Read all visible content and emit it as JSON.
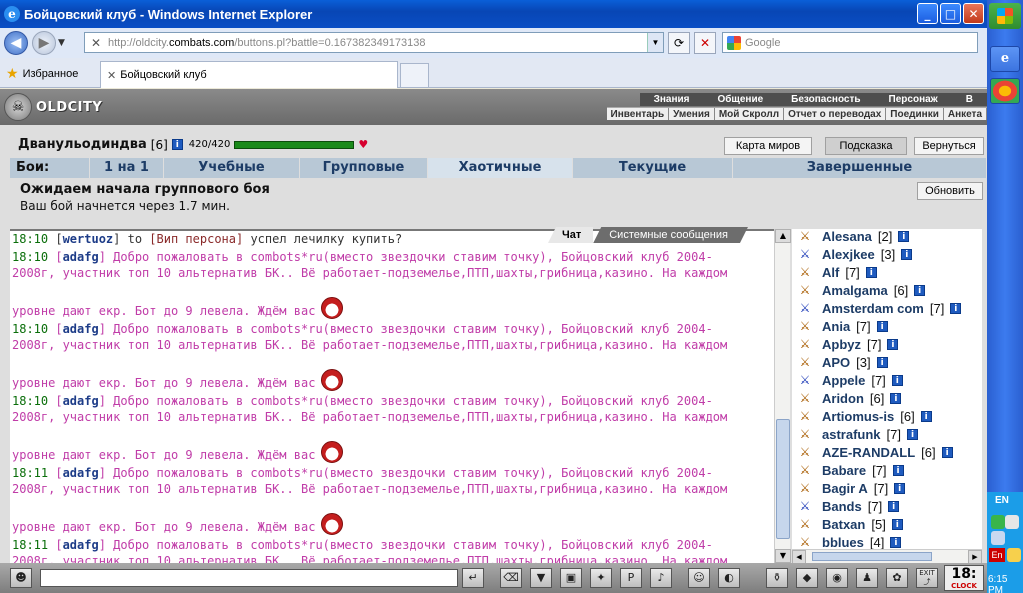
{
  "window": {
    "title": "Бойцовский клуб - Windows Internet Explorer",
    "min": "_",
    "max": "□",
    "close": "✕"
  },
  "address": {
    "url_prefix": "http://oldcity.",
    "url_domain": "combats.com",
    "url_path": "/buttons.pl?battle=0.167382349173138",
    "search_placeholder": "Google"
  },
  "tabs": {
    "favorites": "Избранное",
    "active_tab": "Бойцовский клуб"
  },
  "game": {
    "logo": "OLDCITY",
    "menu_top": [
      "Знания",
      "Общение",
      "Безопасность",
      "Персонаж",
      "В"
    ],
    "menu_sub": [
      "Инвентарь",
      "Умения",
      "Мой Скролл",
      "Отчет о переводах",
      "Поединки",
      "Анкета"
    ],
    "character": {
      "name": "Дванульодиндва",
      "level": "[6]",
      "hp": "420/420",
      "hp_fraction": 1.0
    },
    "buttons": {
      "map": "Карта миров",
      "hint": "Подсказка",
      "back": "Вернуться",
      "refresh": "Обновить"
    },
    "battle_tabs": {
      "label": "Бои:",
      "items": [
        "1 на 1",
        "Учебные",
        "Групповые",
        "Хаотичные",
        "Текущие",
        "Завершенные"
      ],
      "active": "Хаотичные"
    },
    "waiting": {
      "title": "Ожидаем начала группового боя",
      "subtitle": "Ваш бой начнется через 1.7 мин."
    },
    "chat_tabs": [
      "Чат",
      "Системные сообщения"
    ],
    "chat": {
      "first": {
        "time": "18:10",
        "nick": "wertuoz",
        "to_word": "to",
        "to_nick": "[Вип персона]",
        "text": "успел лечилку купить?"
      },
      "promo_line1": "Добро пожаловать в combots*ru(вместо звездочки ставим точку), Бойцовский клуб 2004-",
      "promo_line2": "2008г, участник топ 10 альтернатив БК.. Вё работает-подземелье,ПТП,шахты,грибница,казино. На каждом",
      "promo_line3": "уровне дают екр. Бот до 9 левела. Ждём вас",
      "promo_times": [
        "18:10",
        "18:10",
        "18:10",
        "18:11",
        "18:11"
      ],
      "promo_nick": "adafg"
    },
    "online": [
      {
        "name": "Alesana",
        "level": "[2]",
        "icon": "sword-icon"
      },
      {
        "name": "Alexjkee",
        "level": "[3]",
        "icon": "sword-icon"
      },
      {
        "name": "Alf",
        "level": "[7]",
        "icon": "sword-icon"
      },
      {
        "name": "Amalgama",
        "level": "[6]",
        "icon": "sword-icon"
      },
      {
        "name": "Amsterdam com",
        "level": "[7]",
        "icon": "sword-icon"
      },
      {
        "name": "Ania",
        "level": "[7]",
        "icon": "sword-icon"
      },
      {
        "name": "Apbyz",
        "level": "[7]",
        "icon": "sword-icon"
      },
      {
        "name": "APO",
        "level": "[3]",
        "icon": "sword-icon"
      },
      {
        "name": "Appele",
        "level": "[7]",
        "icon": "sword-icon"
      },
      {
        "name": "Aridon",
        "level": "[6]",
        "icon": "sword-icon"
      },
      {
        "name": "Artiomus-is",
        "level": "[6]",
        "icon": "sword-icon"
      },
      {
        "name": "astrafunk",
        "level": "[7]",
        "icon": "sword-icon"
      },
      {
        "name": "AZE-RANDALL",
        "level": "[6]",
        "icon": "sword-icon"
      },
      {
        "name": "Babare",
        "level": "[7]",
        "icon": "sword-icon"
      },
      {
        "name": "Bagir A",
        "level": "[7]",
        "icon": "sword-icon"
      },
      {
        "name": "Bands",
        "level": "[7]",
        "icon": "sword-icon"
      },
      {
        "name": "Batxan",
        "level": "[5]",
        "icon": "sword-icon"
      },
      {
        "name": "bblues",
        "level": "[4]",
        "icon": "sword-icon"
      }
    ],
    "clock": "18:",
    "clock_label": "CLOCK",
    "exit_label": "EXIT"
  },
  "taskbar": {
    "lang": "EN",
    "keyboard": "En",
    "time": "6:15 PM"
  }
}
